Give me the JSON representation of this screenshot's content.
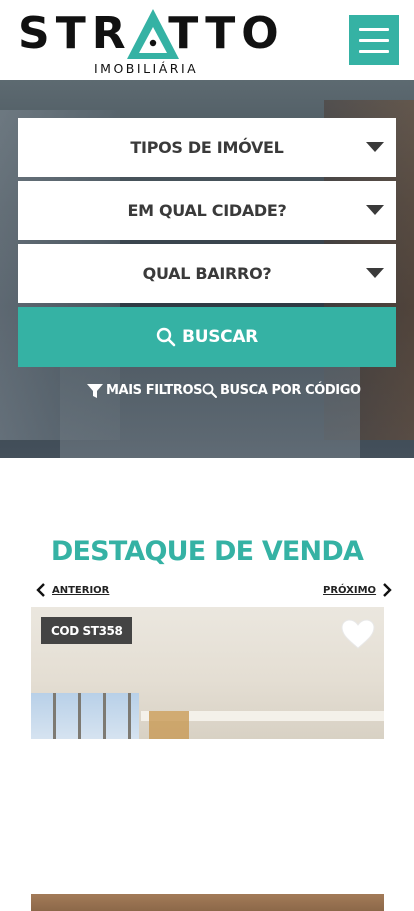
{
  "header": {
    "logo_word": "STRATTO",
    "logo_sub": "IMOBILIÁRIA",
    "menu_icon": "hamburger-menu-icon",
    "brand_color": "#35b2a4"
  },
  "search": {
    "fields": [
      {
        "label": "TIPOS DE IMÓVEL"
      },
      {
        "label": "EM QUAL CIDADE?"
      },
      {
        "label": "QUAL BAIRRO?"
      }
    ],
    "button_label": "BUSCAR",
    "links": {
      "more_filters": "MAIS FILTROS",
      "by_code": "BUSCA POR CÓDIGO"
    }
  },
  "featured": {
    "title": "DESTAQUE DE VENDA",
    "prev_label": "ANTERIOR",
    "next_label": "PRÓXIMO",
    "cards": [
      {
        "code": "COD ST358"
      }
    ]
  }
}
